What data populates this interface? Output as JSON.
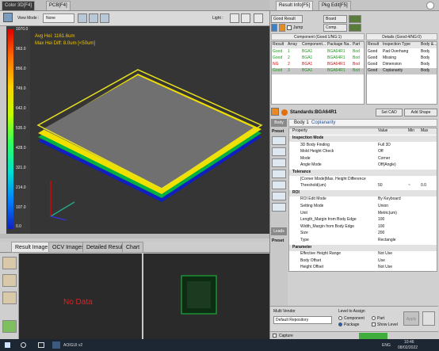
{
  "left": {
    "tabs": [
      "Color 3D[F4]",
      "PCB[F4]"
    ],
    "toolbar": {
      "view_mode_label": "View Mode :",
      "view_mode_value": "None",
      "light_label": "Light :"
    },
    "scale_ticks": [
      "1070.0",
      "963.0",
      "856.0",
      "749.0",
      "642.0",
      "535.0",
      "428.0",
      "321.0",
      "214.0",
      "107.0",
      "0.0"
    ],
    "overlay": {
      "avg": "Avg Hei: 1161.6um",
      "max": "Max Hei Diff:    8.0um  [<50um]"
    },
    "bottom_tabs": [
      "Result Image",
      "OCV Images",
      "Detailed Result",
      "Chart"
    ],
    "no_data": "No Data"
  },
  "right": {
    "tabs": [
      "Result Info[F5]",
      "Pkg Edit[F5]"
    ],
    "good_result": "Good Result",
    "board": "Board",
    "comp": "Comp.",
    "jump": "Jump",
    "component_header": "Component (Good:1/NG:1)",
    "details_header": "Details (Good:4/NG:0)",
    "comp_cols": [
      "Result",
      "Array",
      "Component...",
      "Package Na...",
      "Part"
    ],
    "comp_rows": [
      {
        "result": "Good",
        "array": "1",
        "component": "BGA1",
        "package": "BGA64R1",
        "part": "Bod"
      },
      {
        "result": "Good",
        "array": "2",
        "component": "BGA1",
        "package": "BGA64R1",
        "part": "Bod"
      },
      {
        "result": "NG",
        "array": "2",
        "component": "BGA1",
        "package": "BGA64R1",
        "part": "Bod"
      },
      {
        "result": "Good",
        "array": "3",
        "component": "BGA1",
        "package": "BGA64R1",
        "part": "Bod"
      }
    ],
    "detail_cols": [
      "Result",
      "Inspection Type",
      "Body &..."
    ],
    "detail_rows": [
      {
        "result": "Good",
        "type": "Pad Overhang",
        "body": "Body"
      },
      {
        "result": "Good",
        "type": "Missing",
        "body": "Body"
      },
      {
        "result": "Good",
        "type": "Dimension",
        "body": "Body"
      },
      {
        "result": "Good",
        "type": "Coplanarity",
        "body": "Body"
      }
    ],
    "standards": "Standards:BGA64R1",
    "set_cad": "Set CAD",
    "add_shape": "Add Shape",
    "body_tab": "Body",
    "body_title": "Body 1",
    "body_sub": "Coplanarity",
    "preset": "Preset",
    "leads": "Leads",
    "preset2": "Preset",
    "prop_cols": [
      "Property",
      "Value",
      "Min",
      "Max"
    ],
    "props": [
      {
        "sec": true,
        "name": "Inspection Mode"
      },
      {
        "name": "3D Body Finding",
        "value": "Full 3D"
      },
      {
        "name": "Mold Height Check",
        "value": "Off"
      },
      {
        "name": "Mode",
        "value": "Corner"
      },
      {
        "name": "Angle Mode",
        "value": "Off(Angle)"
      },
      {
        "sec": true,
        "name": "Tolerance"
      },
      {
        "name": "[Corner Mode]Max. Height Difference",
        "value": ""
      },
      {
        "name": "Threshold(um)",
        "value": "50",
        "min": "~",
        "max": "0.0"
      },
      {
        "sec": true,
        "name": "ROI"
      },
      {
        "name": "ROI Edit Mode",
        "value": "By Keyboard"
      },
      {
        "name": "Setting Mode",
        "value": "Union"
      },
      {
        "name": "Unit",
        "value": "Metric(um)"
      },
      {
        "name": "Length_Margin from Body Edge",
        "value": "100"
      },
      {
        "name": "Width_Margin from Body Edge",
        "value": "100"
      },
      {
        "name": "Size",
        "value": "200"
      },
      {
        "name": "Type",
        "value": "Rectangle"
      },
      {
        "sec": true,
        "name": "Parameter"
      },
      {
        "name": "Effective Height Range",
        "value": "Not Use"
      },
      {
        "name": "Body Offset",
        "value": "Use"
      },
      {
        "name": "Height Offset",
        "value": "Not Use"
      }
    ],
    "multi_vendor": "Multi Vendor",
    "repo": "Default Repository",
    "level_assign": "Level to Assign",
    "component": "Component",
    "part": "Part",
    "package": "Package",
    "show_level": "Show Level",
    "apply": "Apply",
    "capture": "Capture"
  },
  "taskbar": {
    "search_placeholder": "Type here to search",
    "app": "AOIGUI v2",
    "lang": "ENG",
    "time": "10:46",
    "date": "08/02/2022"
  }
}
